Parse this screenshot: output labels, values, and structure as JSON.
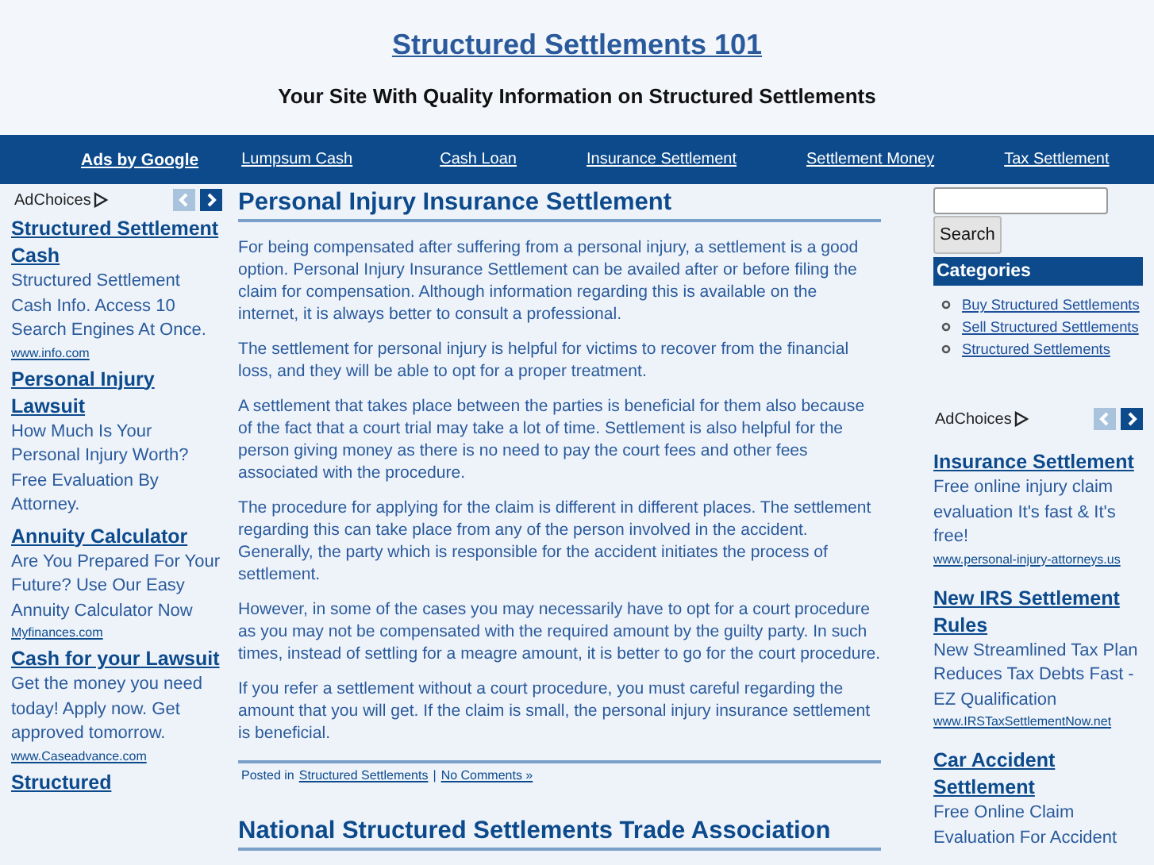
{
  "header": {
    "title": "Structured Settlements 101",
    "tagline": "Your Site With Quality Information on Structured Settlements"
  },
  "nav": {
    "label": "Ads by Google",
    "links": [
      "Lumpsum Cash",
      "Cash Loan",
      "Insurance Settlement",
      "Settlement Money",
      "Tax Settlement"
    ]
  },
  "left_ads": {
    "label": "AdChoices",
    "prev_disabled": true,
    "ads": [
      {
        "title": "Structured Settlement Cash",
        "text": "Structured Settlement Cash Info. Access 10 Search Engines At Once.",
        "url": "www.info.com"
      },
      {
        "title": "Personal Injury Lawsuit",
        "text": "How Much Is Your Personal Injury Worth? Free Evaluation By Attorney."
      },
      {
        "title": "Annuity Calculator",
        "text": "Are You Prepared For Your Future? Use Our Easy Annuity Calculator Now",
        "url": "Myfinances.com"
      },
      {
        "title": "Cash for your Lawsuit",
        "text": "Get the money you need today! Apply now. Get approved tomorrow.",
        "url": "www.Caseadvance.com"
      },
      {
        "title": "Structured"
      }
    ]
  },
  "posts": [
    {
      "title": "Personal Injury Insurance Settlement",
      "paragraphs": [
        "For being compensated after suffering from a personal injury, a settlement is a good option. Personal Injury Insurance Settlement can be availed after or before filing the claim for compensation. Although information regarding this is available on the internet, it is always better to consult a professional.",
        "The settlement for personal injury is helpful for victims to recover from the financial loss, and they will be able to opt for a proper treatment.",
        "A settlement that takes place between the parties is beneficial for them also because of the fact that a court trial may take a lot of time. Settlement is also helpful for the person giving money as there is no need to pay the court fees and other fees associated with the procedure.",
        "The procedure for applying for the claim is different in different places. The settlement regarding this can take place from any of the person involved in the accident. Generally, the party which is responsible for the accident initiates the process of settlement.",
        "However, in some of the cases you may necessarily have to opt for a court procedure as you may not be compensated with the required amount by the guilty party. In such times, instead of settling for a meagre amount, it is better to go for the court procedure.",
        "If you refer a settlement without a court procedure, you must careful regarding the amount that you will get. If the claim is small, the personal injury insurance settlement is beneficial."
      ],
      "meta": {
        "prefix": "Posted in",
        "category": "Structured Settlements",
        "separator": "|",
        "comments": "No Comments »"
      }
    },
    {
      "title": "National Structured Settlements Trade Association"
    }
  ],
  "search": {
    "button": "Search"
  },
  "categories": {
    "title": "Categories",
    "items": [
      "Buy Structured Settlements",
      "Sell Structured Settlements",
      "Structured Settlements"
    ]
  },
  "right_ads": {
    "label": "AdChoices",
    "prev_disabled": true,
    "ads": [
      {
        "title": "Insurance Settlement",
        "text": "Free online injury claim evaluation It's fast & It's free!",
        "url": "www.personal-injury-attorneys.us"
      },
      {
        "title": "New IRS Settlement Rules",
        "text": "New Streamlined Tax Plan Reduces Tax Debts Fast - EZ Qualification",
        "url": "www.IRSTaxSettlementNow.net"
      },
      {
        "title": "Car Accident Settlement",
        "text": "Free Online Claim Evaluation For Accident"
      }
    ]
  }
}
